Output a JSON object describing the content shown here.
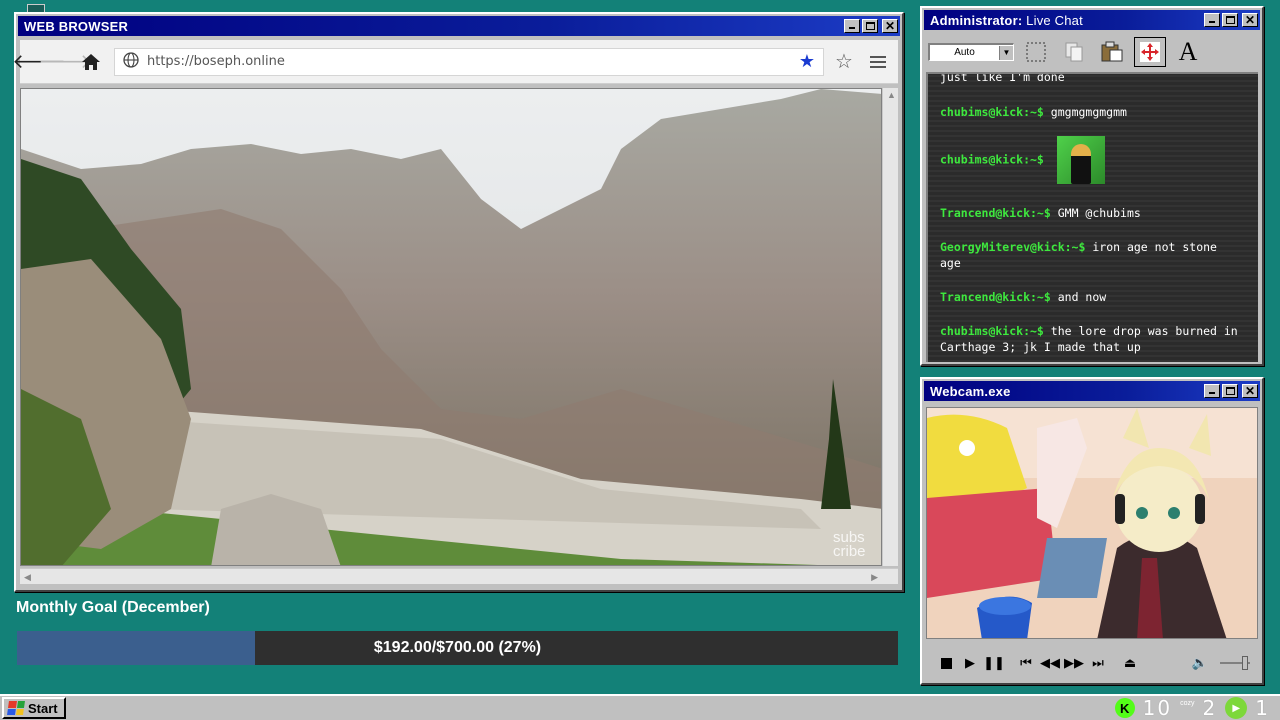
{
  "browser": {
    "title": "WEB BROWSER",
    "url": "https://boseph.online",
    "video_watermark": "subs cribe"
  },
  "chat": {
    "title_prefix": "Administrator:",
    "title_rest": " Live Chat",
    "select_value": "Auto",
    "tool_text_icon": "A",
    "partial_top_line": "just like I'm done",
    "messages": [
      {
        "user": "chubims@kick:~$",
        "text": "gmgmgmgmgmm"
      },
      {
        "user": "chubims@kick:~$",
        "text": "",
        "emote": "green-screen-emote"
      },
      {
        "user": "Trancend@kick:~$",
        "text": "GMM @chubims"
      },
      {
        "user": "GeorgyMiterev@kick:~$",
        "text": "iron age not stone age"
      },
      {
        "user": "Trancend@kick:~$",
        "text": "and now"
      },
      {
        "user": "chubims@kick:~$",
        "text": "the lore drop was burned in Carthage 3; jk I made that up"
      }
    ]
  },
  "webcam": {
    "title": "Webcam.exe"
  },
  "goal": {
    "title": "Monthly Goal (December)",
    "text": "$192.00/$700.00 (27%)",
    "progress": 0.27
  },
  "taskbar": {
    "start_label": "Start",
    "kick_label": "K",
    "count_a": "10",
    "cozy_label": "cozy",
    "count_b": "2",
    "count_c": "1"
  },
  "colors": {
    "desktop": "#138178",
    "title_bar": "#000080",
    "chat_user": "#3ee83e",
    "goal_fill": "#3b5f8e",
    "kick_green": "#53fc18"
  }
}
